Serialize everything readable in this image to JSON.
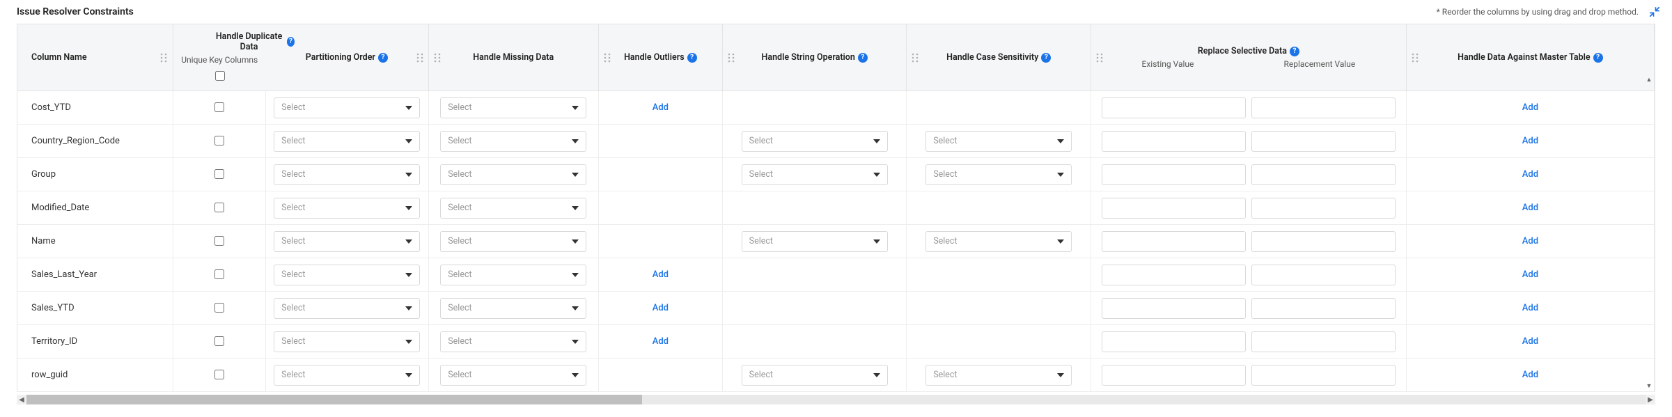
{
  "header": {
    "title": "Issue Resolver Constraints",
    "hint": "* Reorder the columns by using drag and drop method."
  },
  "labels": {
    "select_placeholder": "Select",
    "add": "Add"
  },
  "columns": {
    "name": "Column Name",
    "dup_group": "Handle Duplicate Data",
    "unique_sub": "Unique Key Columns",
    "partition": "Partitioning Order",
    "missing": "Handle Missing Data",
    "outliers": "Handle Outliers",
    "string_op": "Handle String Operation",
    "case_sens": "Handle Case Sensitivity",
    "replace_group": "Replace Selective Data",
    "replace_existing": "Existing Value",
    "replace_new": "Replacement Value",
    "master": "Handle Data Against Master Table"
  },
  "rows": [
    {
      "name": "Cost_YTD",
      "outlier_add": true,
      "string_op": false,
      "case_sens": false
    },
    {
      "name": "Country_Region_Code",
      "outlier_add": false,
      "string_op": true,
      "case_sens": true
    },
    {
      "name": "Group",
      "outlier_add": false,
      "string_op": true,
      "case_sens": true
    },
    {
      "name": "Modified_Date",
      "outlier_add": false,
      "string_op": false,
      "case_sens": false
    },
    {
      "name": "Name",
      "outlier_add": false,
      "string_op": true,
      "case_sens": true
    },
    {
      "name": "Sales_Last_Year",
      "outlier_add": true,
      "string_op": false,
      "case_sens": false
    },
    {
      "name": "Sales_YTD",
      "outlier_add": true,
      "string_op": false,
      "case_sens": false
    },
    {
      "name": "Territory_ID",
      "outlier_add": true,
      "string_op": false,
      "case_sens": false
    },
    {
      "name": "row_guid",
      "outlier_add": false,
      "string_op": true,
      "case_sens": true
    }
  ]
}
